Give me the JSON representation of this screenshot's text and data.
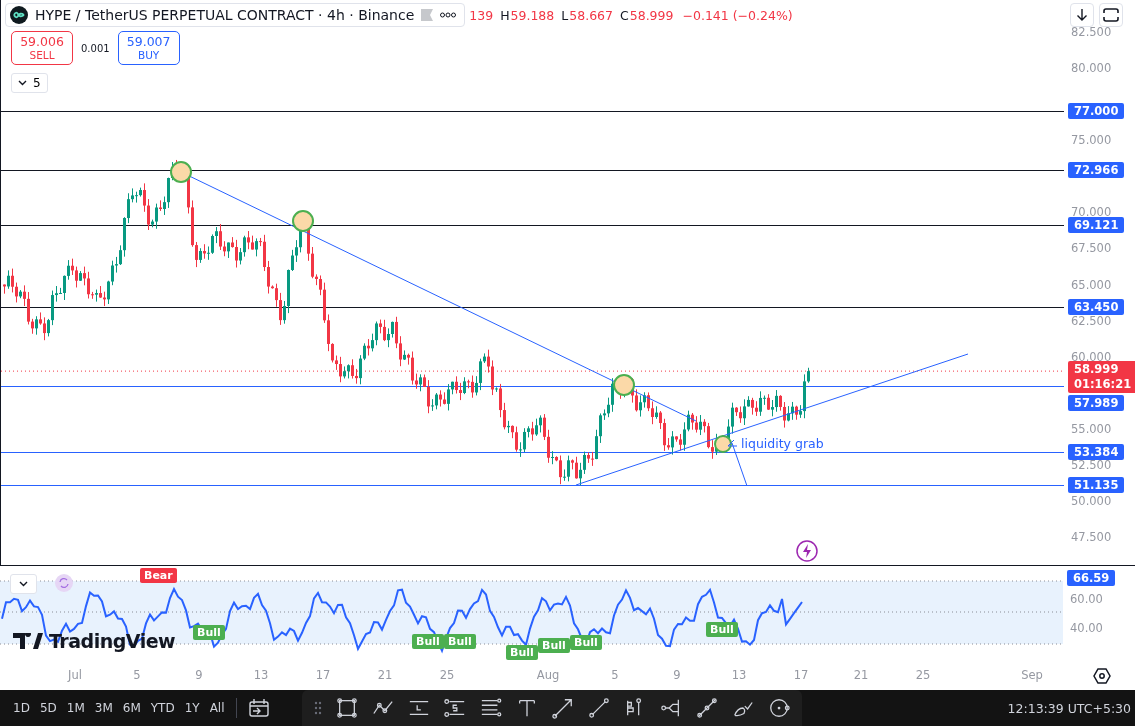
{
  "header": {
    "symbol_title": "HYPE / TetherUS PERPETUAL CONTRACT · 4h · Binance",
    "ohlc": [
      {
        "value": "139"
      },
      {
        "label": "H",
        "value": "59.188"
      },
      {
        "label": "L",
        "value": "58.667"
      },
      {
        "label": "C",
        "value": "58.999"
      }
    ],
    "change": "−0.141 (−0.24%)"
  },
  "trade": {
    "sell_price": "59.006",
    "sell_label": "SELL",
    "spread": "0.001",
    "buy_price": "59.007",
    "buy_label": "BUY"
  },
  "indicators_count": "5",
  "price_axis": {
    "ticks": [
      "82.500",
      "80.000",
      "75.000",
      "70.000",
      "67.500",
      "65.000",
      "62.500",
      "60.000",
      "55.000",
      "52.500",
      "50.000",
      "47.500"
    ],
    "levels": [
      {
        "value": "77.000",
        "color": "#131722"
      },
      {
        "value": "72.966",
        "color": "#131722"
      },
      {
        "value": "69.121",
        "color": "#131722"
      },
      {
        "value": "63.450",
        "color": "#131722"
      },
      {
        "value": "57.989",
        "color": "#2962ff"
      },
      {
        "value": "53.384",
        "color": "#2962ff"
      },
      {
        "value": "51.135",
        "color": "#2962ff"
      }
    ],
    "current": {
      "price": "58.999",
      "countdown": "01:16:21"
    }
  },
  "annotation": "liquidity grab",
  "logo": "TradingView",
  "rsi": {
    "value": "66.59",
    "ticks": [
      "60.00",
      "40.00"
    ],
    "labels": [
      {
        "kind": "bear",
        "text": "Bear"
      },
      {
        "kind": "bull",
        "text": "Bull"
      },
      {
        "kind": "bull",
        "text": "Bull"
      },
      {
        "kind": "bull",
        "text": "Bull"
      },
      {
        "kind": "bull",
        "text": "Bull"
      },
      {
        "kind": "bull",
        "text": "Bull"
      },
      {
        "kind": "bull",
        "text": "Bull"
      },
      {
        "kind": "bull",
        "text": "Bull"
      }
    ]
  },
  "time_axis": [
    "Jul",
    "5",
    "9",
    "13",
    "17",
    "21",
    "25",
    "Aug",
    "5",
    "9",
    "13",
    "17",
    "21",
    "25",
    "Sep"
  ],
  "range_buttons": [
    "1D",
    "5D",
    "1M",
    "3M",
    "6M",
    "YTD",
    "1Y",
    "All"
  ],
  "clock": "12:13:39 UTC+5:30"
}
